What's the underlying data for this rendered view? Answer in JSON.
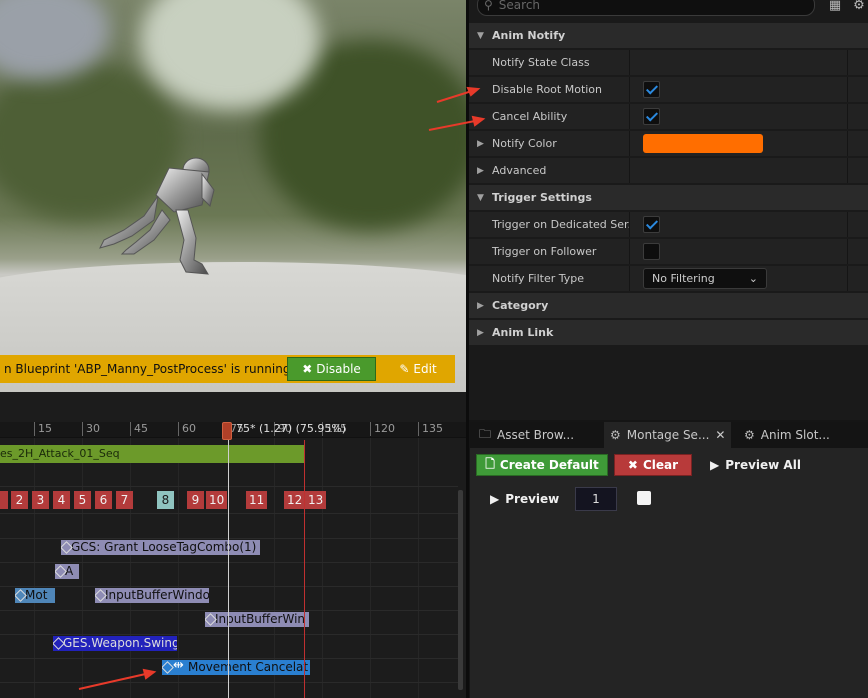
{
  "viewport": {
    "blueprint_message": "n Blueprint 'ABP_Manny_PostProcess' is running.",
    "disable_label": "Disable",
    "edit_label": "Edit"
  },
  "details": {
    "search_placeholder": "Search",
    "categories": {
      "anim_notify": "Anim Notify",
      "trigger_settings": "Trigger Settings",
      "category": "Category",
      "anim_link": "Anim Link"
    },
    "properties": {
      "notify_state_class": {
        "label": "Notify State Class"
      },
      "disable_root_motion": {
        "label": "Disable Root Motion",
        "checked": true
      },
      "cancel_ability": {
        "label": "Cancel Ability",
        "checked": true
      },
      "notify_color": {
        "label": "Notify Color",
        "color": "#ff6e00"
      },
      "advanced": {
        "label": "Advanced"
      },
      "trigger_dedicated": {
        "label": "Trigger on Dedicated Ser...",
        "checked": true
      },
      "trigger_follower": {
        "label": "Trigger on Follower",
        "checked": false
      },
      "notify_filter_type": {
        "label": "Notify Filter Type",
        "value": "No Filtering"
      }
    },
    "accent_color": "#2b8ae0"
  },
  "timeline": {
    "scrubber_label": "75* (1.27) (75.95%)",
    "ruler_ticks": [
      "15",
      "30",
      "45",
      "60",
      "75",
      "90",
      "105",
      "120",
      "135"
    ],
    "montage_slot": "es_2H_Attack_01_Seq",
    "sections": [
      "2",
      "3",
      "4",
      "5",
      "6",
      "7",
      "8",
      "9",
      "10",
      "11",
      "12",
      "13"
    ],
    "selected_section": "8",
    "notifies": {
      "gcs_grant": "GCS: Grant LooseTagCombo(1)",
      "small_a": "A",
      "mot": "Mot",
      "input_buffer_1": "InputBufferWindo",
      "input_buffer_2": "InputBufferWin",
      "ges_weapon": "GES.Weapon.Swing",
      "movement_cancel": "Movement Cancelat"
    }
  },
  "tabs": {
    "asset_browser": "Asset Brow...",
    "montage_sections": "Montage Se...",
    "anim_slot": "Anim Slot..."
  },
  "montage_sections": {
    "create_default": "Create Default",
    "clear": "Clear",
    "preview_all": "Preview All",
    "preview": "Preview",
    "preview_count": "1"
  }
}
